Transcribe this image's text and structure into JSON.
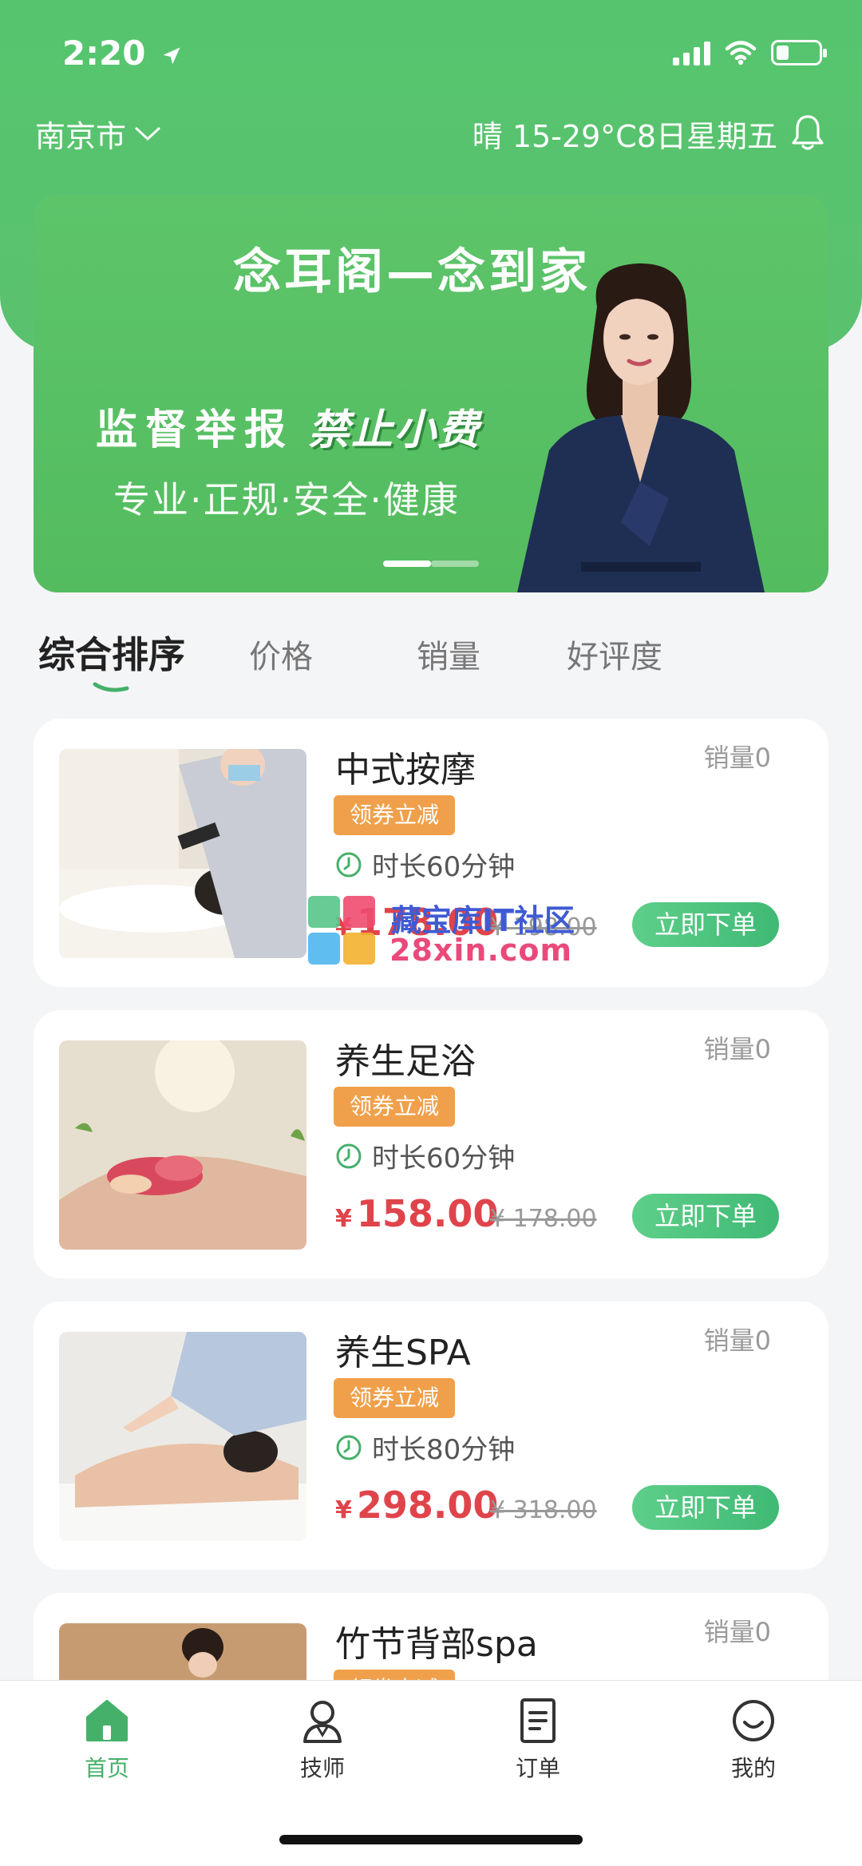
{
  "status_bar": {
    "time": "2:20"
  },
  "header": {
    "city": "南京市",
    "weather": "晴 15-29°C8日星期五"
  },
  "banner": {
    "title": "念耳阁—念到家",
    "slogan_prefix": "监督举报",
    "slogan_highlight": "禁止小费",
    "slogan_sub": "专业·正规·安全·健康"
  },
  "sort_tabs": [
    {
      "label": "综合排序",
      "active": true
    },
    {
      "label": "价格",
      "active": false
    },
    {
      "label": "销量",
      "active": false
    },
    {
      "label": "好评度",
      "active": false
    }
  ],
  "services": [
    {
      "title": "中式按摩",
      "sales": "销量0",
      "coupon": "领券立减",
      "duration": "时长60分钟",
      "currency": "¥",
      "price": "178.00",
      "original_price": "¥ 198.00",
      "buy_label": "立即下单"
    },
    {
      "title": "养生足浴",
      "sales": "销量0",
      "coupon": "领券立减",
      "duration": "时长60分钟",
      "currency": "¥",
      "price": "158.00",
      "original_price": "¥ 178.00",
      "buy_label": "立即下单"
    },
    {
      "title": "养生SPA",
      "sales": "销量0",
      "coupon": "领券立减",
      "duration": "时长80分钟",
      "currency": "¥",
      "price": "298.00",
      "original_price": "¥ 318.00",
      "buy_label": "立即下单"
    },
    {
      "title": "竹节背部spa",
      "sales": "销量0",
      "coupon": "领券立减",
      "duration": "",
      "currency": "",
      "price": "",
      "original_price": "",
      "buy_label": ""
    }
  ],
  "watermark": {
    "line1": "藏宝库IT社区",
    "line2": "28xin.com"
  },
  "bottom_nav": [
    {
      "label": "首页",
      "icon": "home-icon",
      "active": true
    },
    {
      "label": "技师",
      "icon": "technician-icon",
      "active": false
    },
    {
      "label": "订单",
      "icon": "order-icon",
      "active": false
    },
    {
      "label": "我的",
      "icon": "profile-icon",
      "active": false
    }
  ],
  "colors": {
    "brand_green": "#56c46e",
    "price_red": "#e0444b",
    "coupon_orange": "#f0a04b",
    "buy_green": "#3fb974"
  }
}
